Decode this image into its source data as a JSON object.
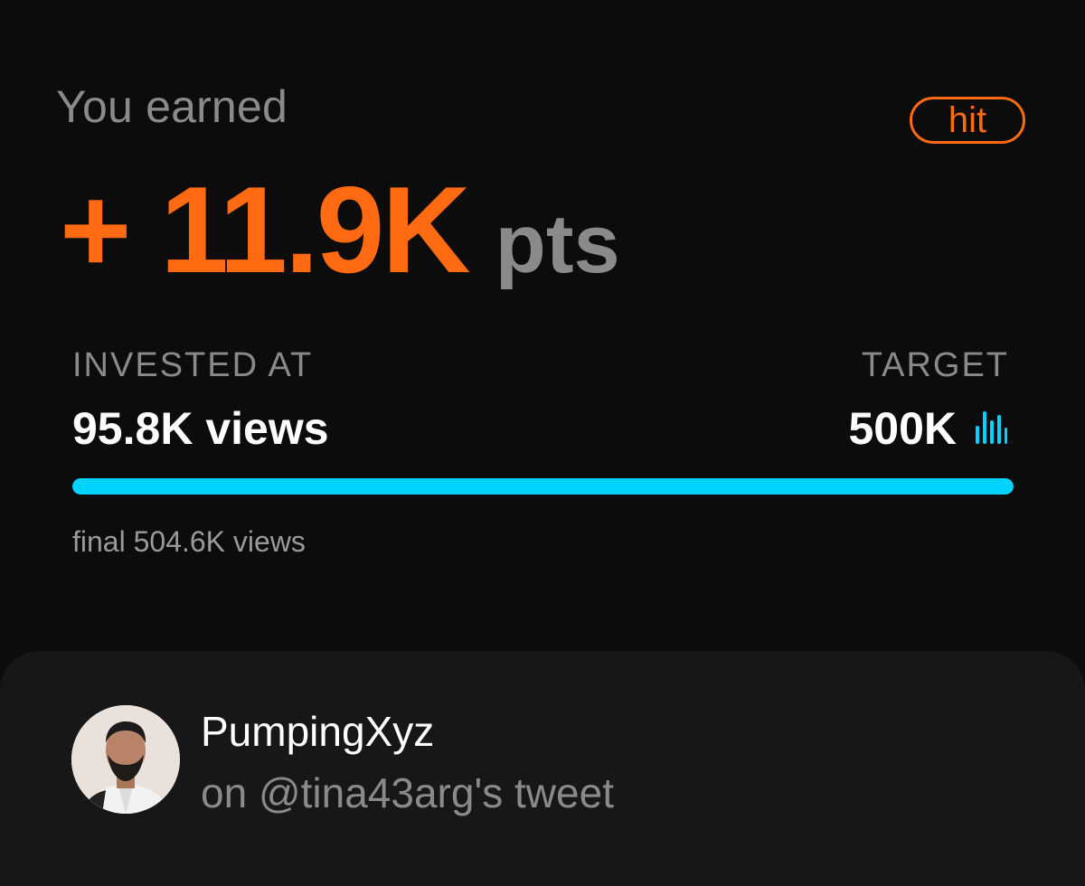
{
  "header": {
    "earned_label": "You earned",
    "status_badge": "hit"
  },
  "points": {
    "value": "+ 11.9K",
    "unit": "pts"
  },
  "investment": {
    "invested_label": "INVESTED AT",
    "invested_value": "95.8K views",
    "target_label": "TARGET",
    "target_value": "500K",
    "target_icon": "bar-chart-icon",
    "progress_fraction": 1.0,
    "final_text": "final 504.6K views"
  },
  "profile": {
    "username": "PumpingXyz",
    "subtitle": "on @tina43arg's tweet",
    "avatar_icon": "user-avatar"
  },
  "colors": {
    "accent_orange": "#ff6a13",
    "progress_cyan": "#00d3ff",
    "muted_text": "#8a8a8a",
    "background": "#0c0c0c",
    "card_background": "#171717"
  }
}
